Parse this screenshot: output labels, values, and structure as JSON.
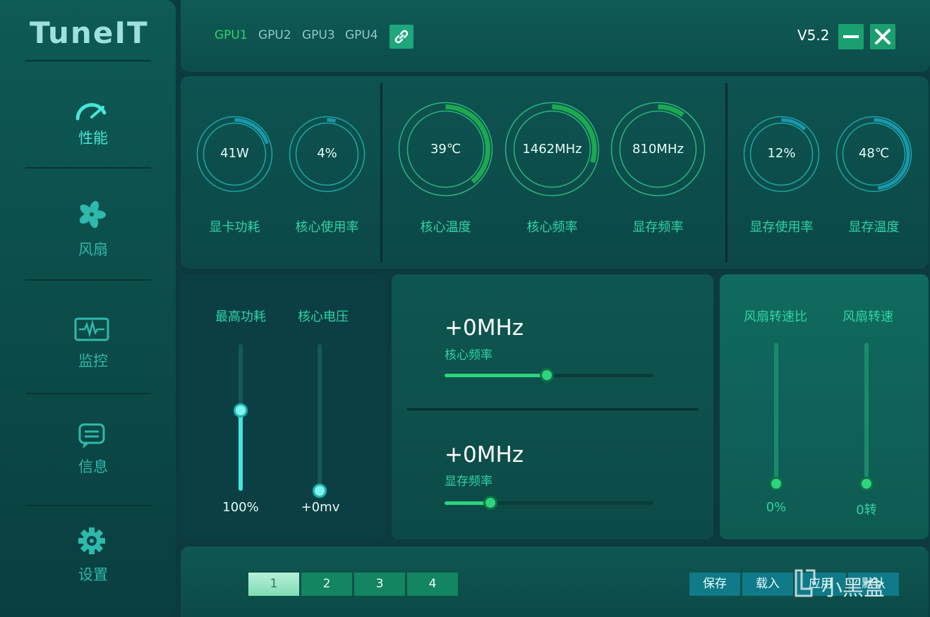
{
  "app": {
    "logo": "TuneIT",
    "version": "V5.2"
  },
  "colors": {
    "accent_green": "#29d66a",
    "teal_label": "#2ed4a4",
    "slider_cyan": "#46e6e0"
  },
  "sidebar": {
    "items": [
      {
        "label": "性能",
        "icon": "speedometer-icon"
      },
      {
        "label": "风扇",
        "icon": "fan-icon"
      },
      {
        "label": "监控",
        "icon": "monitor-pulse-icon"
      },
      {
        "label": "信息",
        "icon": "chat-bubble-icon"
      },
      {
        "label": "设置",
        "icon": "gear-icon"
      }
    ]
  },
  "topbar": {
    "gpu_tabs": [
      "GPU1",
      "GPU2",
      "GPU3",
      "GPU4"
    ],
    "active_tab": "GPU1",
    "link_icon": "link-icon",
    "minimize_icon": "minimize-icon",
    "close_icon": "close-icon"
  },
  "stats": [
    {
      "label": "显卡功耗",
      "value": "41W",
      "fill": 0.2
    },
    {
      "label": "核心使用率",
      "value": "4%",
      "fill": 0.04
    },
    {
      "label": "核心温度",
      "value": "39℃",
      "fill": 0.39
    },
    {
      "label": "核心频率",
      "value": "1462MHz",
      "fill": 0.3
    },
    {
      "label": "显存频率",
      "value": "810MHz",
      "fill": 0.1
    },
    {
      "label": "显存使用率",
      "value": "12%",
      "fill": 0.12
    },
    {
      "label": "显存温度",
      "value": "48℃",
      "fill": 0.48
    }
  ],
  "power_voltage": {
    "power_label": "最高功耗",
    "power_value": "100%",
    "power_level": 0.55,
    "voltage_label": "核心电压",
    "voltage_value": "+0mv",
    "voltage_level": 0.0
  },
  "clocks": {
    "core_value": "+0MHz",
    "core_label": "核心频率",
    "core_level": 0.49,
    "mem_value": "+0MHz",
    "mem_label": "显存频率",
    "mem_level": 0.22
  },
  "fan": {
    "ratio_label": "风扇转速比",
    "ratio_value": "0%",
    "ratio_level": 0.0,
    "speed_label": "风扇转速",
    "speed_value": "0转",
    "speed_level": 0.0
  },
  "bottombar": {
    "profiles": [
      "1",
      "2",
      "3",
      "4"
    ],
    "active_profile": "1",
    "save": "保存",
    "load": "载入",
    "apply": "应用",
    "default": "默认",
    "watermark": "小黑盒"
  }
}
